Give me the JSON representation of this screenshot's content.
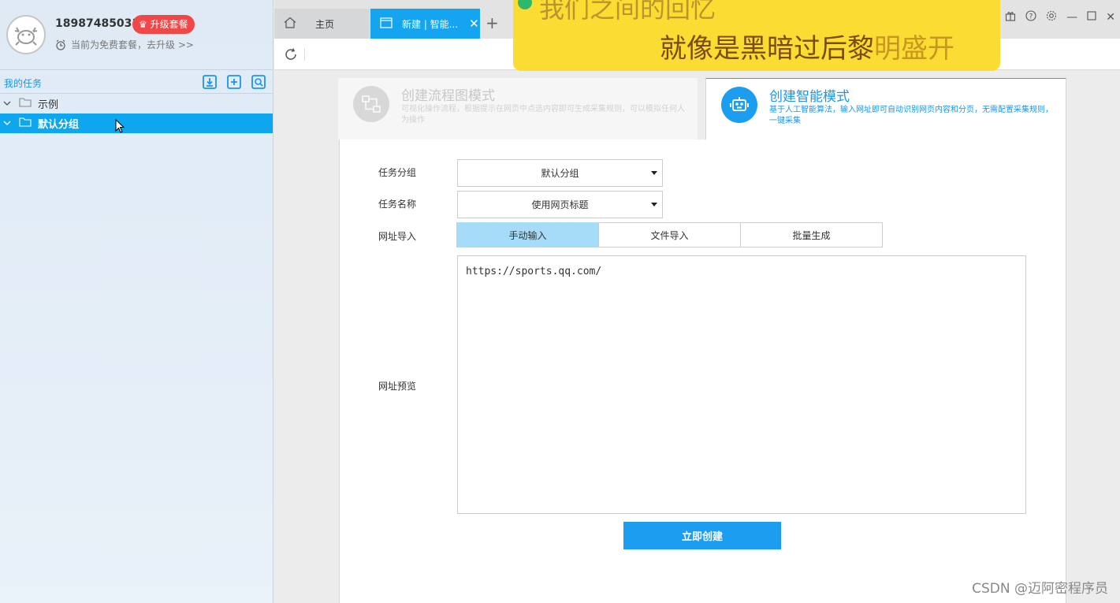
{
  "user": {
    "phone": "18987485031",
    "upgrade_badge": "升级套餐",
    "plan_text": "当前为免费套餐，去升级 >>"
  },
  "sidebar": {
    "task_title": "我的任务",
    "items": [
      {
        "label": "示例"
      },
      {
        "label": "默认分组"
      }
    ]
  },
  "tabs": [
    {
      "label": "主页"
    },
    {
      "label": "新建 | 智能..."
    }
  ],
  "lyrics": {
    "line1": "我们之间的回忆",
    "line2_sung": "就像是黑暗过后黎",
    "line2_unsung": "明盛开"
  },
  "modes": {
    "flow": {
      "title": "创建流程图模式",
      "desc": "可视化操作流程，根据提示在网页中点选内容即可生成采集规则，可以模拟任何人为操作"
    },
    "smart": {
      "title": "创建智能模式",
      "desc": "基于人工智能算法，输入网址即可自动识别网页内容和分页，无需配置采集规则，一键采集"
    }
  },
  "form": {
    "group_label": "任务分组",
    "group_value": "默认分组",
    "name_label": "任务名称",
    "name_value": "使用网页标题",
    "import_label": "网址导入",
    "import_options": [
      "手动输入",
      "文件导入",
      "批量生成"
    ],
    "preview_label": "网址预览",
    "url_text": "https://sports.qq.com/",
    "create_button": "立即创建"
  },
  "watermark": "CSDN @迈阿密程序员",
  "colors": {
    "accent": "#1d9df0",
    "sidebar_active": "#0ea6ee",
    "badge": "#f04848",
    "lyrics_bg": "#fbdc32"
  }
}
